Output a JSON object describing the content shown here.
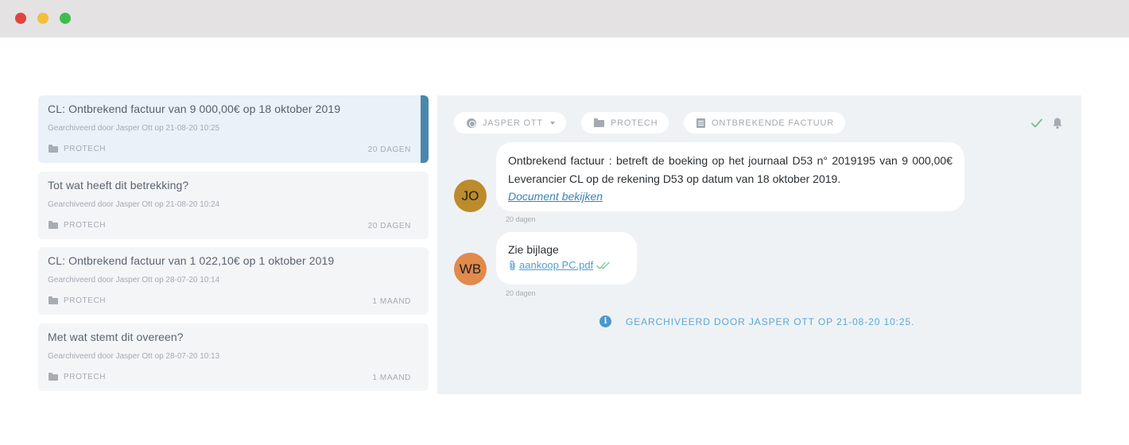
{
  "window": {
    "controls": [
      "close",
      "minimize",
      "maximize"
    ],
    "colors": {
      "close": "#e0443e",
      "minimize": "#f3bf3b",
      "maximize": "#3fbc4e"
    }
  },
  "list": {
    "accent_color": "#4a87ab",
    "items": [
      {
        "title": "CL: Ontbrekend factuur van 9 000,00€ op 18 oktober 2019",
        "subtitle": "Gearchiveerd door Jasper Ott op 21-08-20 10:25",
        "folder": "PROTECH",
        "age": "20 DAGEN",
        "active": true
      },
      {
        "title": "Tot wat heeft dit betrekking?",
        "subtitle": "Gearchiveerd door Jasper Ott op 21-08-20 10:24",
        "folder": "PROTECH",
        "age": "20 DAGEN",
        "active": false
      },
      {
        "title": "CL: Ontbrekend factuur van 1 022,10€ op 1 oktober 2019",
        "subtitle": "Gearchiveerd door Jasper Ott op 28-07-20 10:14",
        "folder": "PROTECH",
        "age": "1 MAAND",
        "active": false
      },
      {
        "title": "Met wat stemt dit overeen?",
        "subtitle": "Gearchiveerd door Jasper Ott op 28-07-20 10:13",
        "folder": "PROTECH",
        "age": "1 MAAND",
        "active": false
      }
    ]
  },
  "detail": {
    "chips": {
      "user": "JASPER OTT",
      "folder": "PROTECH",
      "category": "ONTBREKENDE FACTUUR"
    },
    "icons": {
      "user": "globe-icon",
      "folder": "folder-icon",
      "category": "document-icon",
      "status": "check-icon",
      "notify": "bell-icon"
    },
    "messages": [
      {
        "initials": "JO",
        "avatar_color": "#bb8b2c",
        "text": "Ontbrekend factuur : betreft de boeking op het journaal D53 n° 2019195 van 9 000,00€ Leverancier CL op de rekening D53 op datum van 18 oktober 2019.",
        "link": "Document bekijken",
        "time": "20 dagen"
      },
      {
        "initials": "WB",
        "avatar_color": "#e08a4b",
        "text": "Zie bijlage",
        "attachment": " aankoop PC.pdf ",
        "time": "20 dagen"
      }
    ],
    "system_note": "GEARCHIVEERD DOOR JASPER OTT OP 21-08-20 10:25."
  }
}
